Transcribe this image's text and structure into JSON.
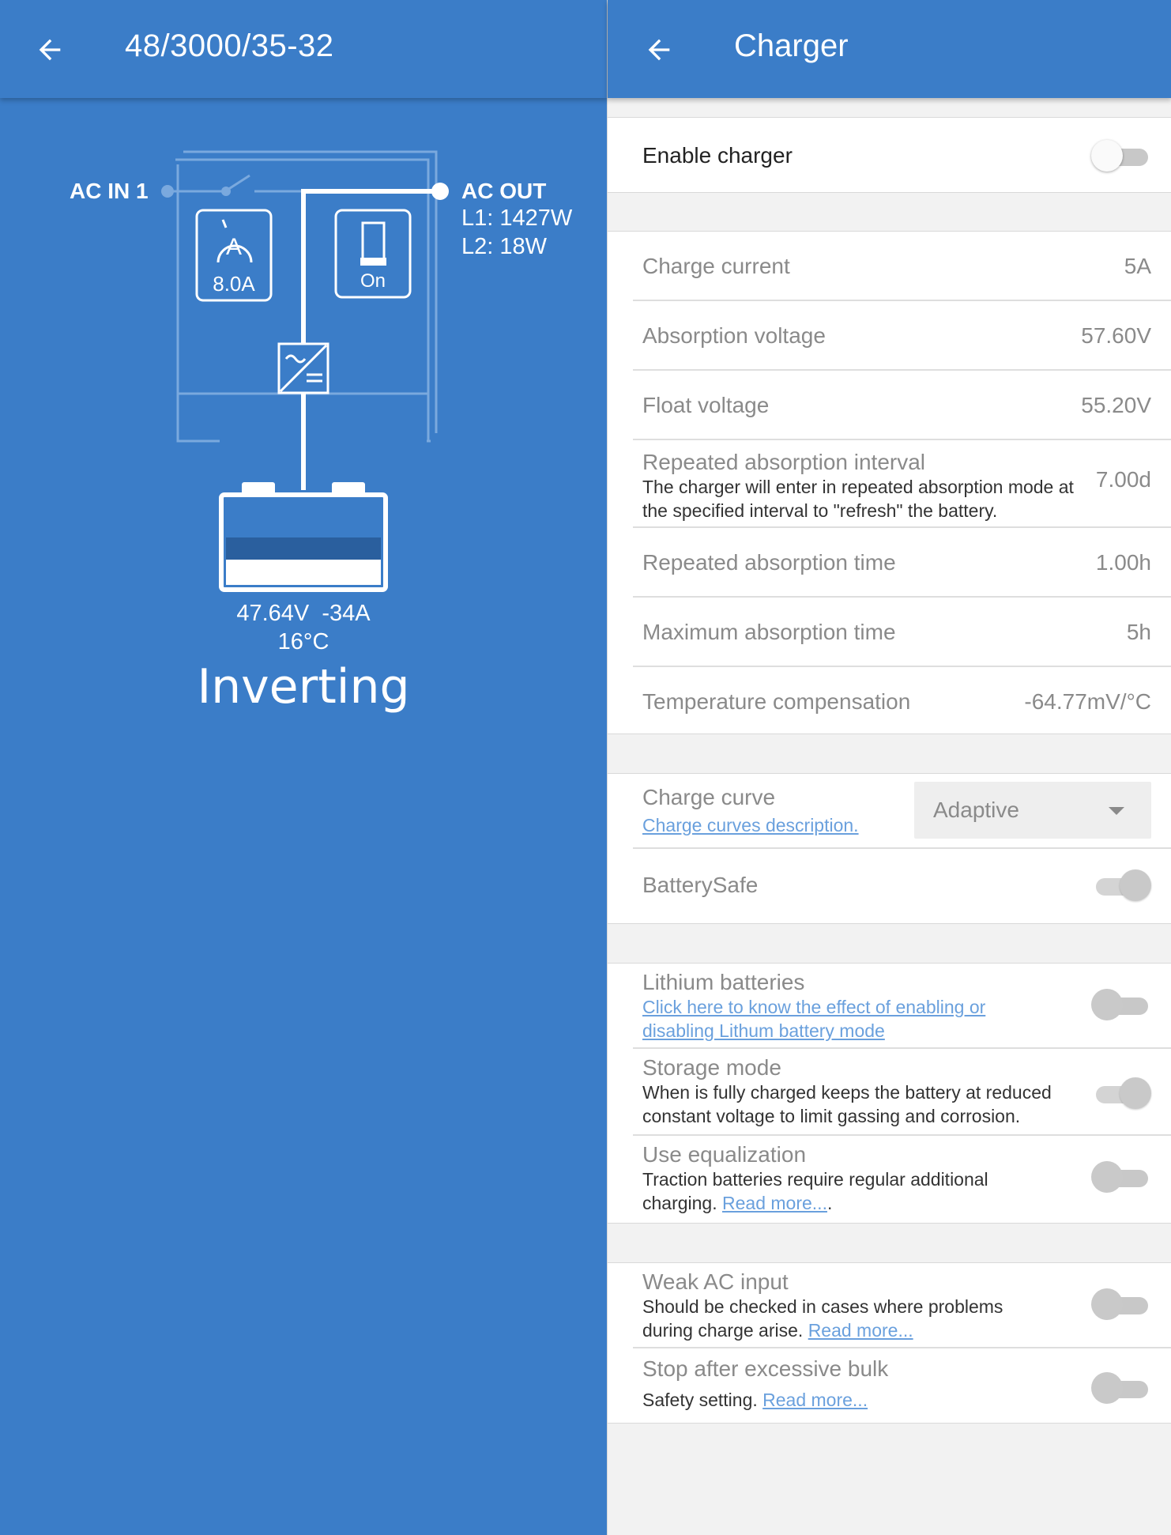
{
  "left": {
    "title": "48/3000/35-32",
    "ac_in": "AC IN 1",
    "ac_out": "AC OUT",
    "l1": "L1: 1427W",
    "l2": "L2: 18W",
    "current_limit": "8.0A",
    "switch_state": "On",
    "battery_voltage_current": "47.64V  -34A",
    "battery_temp": "16°C",
    "state": "Inverting"
  },
  "right": {
    "title": "Charger",
    "enable_charger": {
      "label": "Enable charger",
      "on": false
    },
    "settings": [
      {
        "label": "Charge current",
        "value": "5A"
      },
      {
        "label": "Absorption voltage",
        "value": "57.60V"
      },
      {
        "label": "Float voltage",
        "value": "55.20V"
      },
      {
        "label": "Repeated absorption interval",
        "value": "7.00d",
        "desc": "The charger will enter in repeated absorption mode at the specified interval to \"refresh\" the battery."
      },
      {
        "label": "Repeated absorption time",
        "value": "1.00h"
      },
      {
        "label": "Maximum absorption time",
        "value": "5h"
      },
      {
        "label": "Temperature compensation",
        "value": "-64.77mV/°C"
      }
    ],
    "charge_curve": {
      "label": "Charge curve",
      "link": "Charge curves description.",
      "selected": "Adaptive"
    },
    "battery_safe": {
      "label": "BatterySafe",
      "on": true
    },
    "lithium": {
      "label": "Lithium batteries",
      "link": "Click here to know the effect of enabling or disabling Lithum battery mode",
      "on": false
    },
    "storage": {
      "label": "Storage mode",
      "desc": "When is fully charged keeps the battery at reduced constant voltage to limit gassing and corrosion.",
      "on": true
    },
    "equalization": {
      "label": "Use equalization",
      "desc": "Traction batteries require regular additional charging.",
      "link": "Read more...",
      "suffix": ".",
      "on": false
    },
    "weak_ac": {
      "label": "Weak AC input",
      "desc": "Should be checked in cases where problems during charge arise.",
      "link": "Read more...",
      "on": false
    },
    "stop_bulk": {
      "label": "Stop after excessive bulk",
      "desc": "Safety setting.",
      "link": "Read more...",
      "on": false
    }
  },
  "colors": {
    "header": "#3b7dc8",
    "panel": "#3b7dc8",
    "link": "#6aa0dd"
  }
}
